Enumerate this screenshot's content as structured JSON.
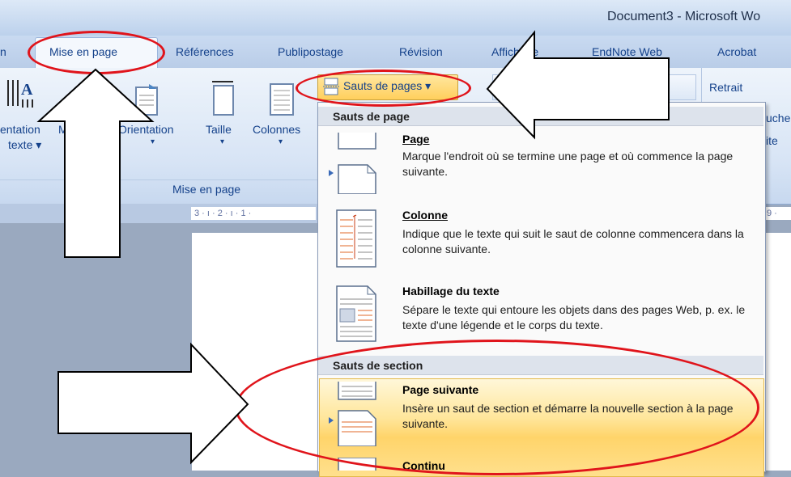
{
  "window": {
    "title": "Document3 - Microsoft Wo"
  },
  "tabs": [
    {
      "label": "n"
    },
    {
      "label": "Mise en page",
      "active": true
    },
    {
      "label": "Références"
    },
    {
      "label": "Publipostage"
    },
    {
      "label": "Révision"
    },
    {
      "label": "Affichage"
    },
    {
      "label": "EndNote Web"
    },
    {
      "label": "Acrobat"
    }
  ],
  "ribbon": {
    "orientation_texte": {
      "line1": "entation",
      "line2": "texte ▾"
    },
    "orientation": {
      "label": "Orientation",
      "arrow": "▾"
    },
    "taille": {
      "label": "Taille",
      "arrow": "▾"
    },
    "colonnes": {
      "label": "Colonnes",
      "arrow": "▾"
    },
    "group_label": "Mise en page",
    "sauts_de_pages": "Sauts de pages ▾",
    "retrait": "Retrait",
    "right_cut_1": "uche",
    "right_cut_2": "ite"
  },
  "ruler": {
    "left": "3 · ı · 2 · ı · 1 ·",
    "right": "9 ·"
  },
  "menu": {
    "section_page_header": "Sauts de page",
    "section_section_header": "Sauts de section",
    "items": [
      {
        "title": "Page",
        "desc": "Marque l'endroit où se termine une page et où commence la page suivante."
      },
      {
        "title": "Colonne",
        "desc": "Indique que le texte qui suit le saut de colonne commencera dans la colonne suivante."
      },
      {
        "title": "Habillage du texte",
        "desc": "Sépare le texte qui entoure les objets dans des pages Web, p. ex. le texte d'une légende et le corps du texte."
      },
      {
        "title": "Page suivante",
        "desc": "Insère un saut de section et démarre la nouvelle section à la page suivante.",
        "highlighted": true
      },
      {
        "title": "Continu",
        "desc": ""
      }
    ]
  },
  "colors": {
    "annotation_red": "#e0141b",
    "highlight": "#ffd46a",
    "ribbon_text": "#15428b"
  }
}
